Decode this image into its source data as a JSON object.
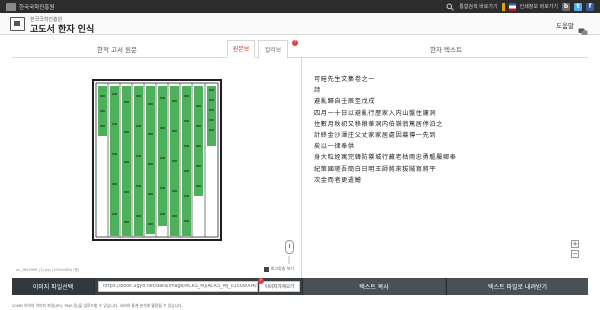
{
  "topbar": {
    "org_name": "한국국학진흥원",
    "links": [
      "통합검색 바로가기",
      "인쇄정보 바로가기",
      "바로가기"
    ],
    "sns": [
      "f",
      "t",
      "b"
    ]
  },
  "header": {
    "app_subtitle": "한국국학진흥원",
    "app_title": "고도서 한자 인식",
    "help_label": "도움말"
  },
  "tabs": {
    "original": "한적 고서 원문",
    "bw": "원본보",
    "color": "컬러보",
    "badge": "?",
    "text": "한자 텍스트"
  },
  "left_pane": {
    "file_name": "ac_1692969_(1).jpg (1920x960) (원)",
    "fit_label": "최고맞춤 보기"
  },
  "recognized_text": [
    "可畦先生文集卷之一",
    "詩",
    "避亂歸自壬辰至戊戌",
    "四月一十日以避亂行歷家入内山盤住廬洞",
    "住數月秋初又移稂華洞内伯嶺翁篤居停泊之",
    "計終金沙渾庄父丈家家居處因蘂傳一先到",
    "矣以一律奉供",
    "身大粒姪寓完韓防禦城行藏老枯雨忠勇驅屬卿奉",
    "紀策國嗟吾簡白日明王師將來拔賊寫將平",
    "次金而者更遣鱠"
  ],
  "bottom_bar": {
    "upload_label": "이미지 파일선택",
    "url_value": "https://book.ugyo.net/data/image/ACKS_MJ/ACKS_MJ_01509004/ACKS_MJ_01",
    "url_badge": "?",
    "load_url_label": "이미지가져오기",
    "copy_label": "텍스트 복사",
    "download_label": "텍스트 파일로 내려받기"
  },
  "footer": {
    "text": "20MB 이하의 이미지 파일(JPG, PNG 등)을 업로드할 수 있습니다. 서버의 통계 분석에 활용될 수 있습니다."
  },
  "colors": {
    "topbar_bg": "#2d2d2d",
    "bottom_bar_bg": "#3b4045",
    "active_tab": "#c0392b",
    "scan_green": "#3aa84a",
    "badge_red": "#e04040"
  },
  "icons": {
    "search": "search-icon",
    "help": "help-chat-icon",
    "zoom_in": "plus-icon",
    "zoom_out": "minus-icon"
  }
}
